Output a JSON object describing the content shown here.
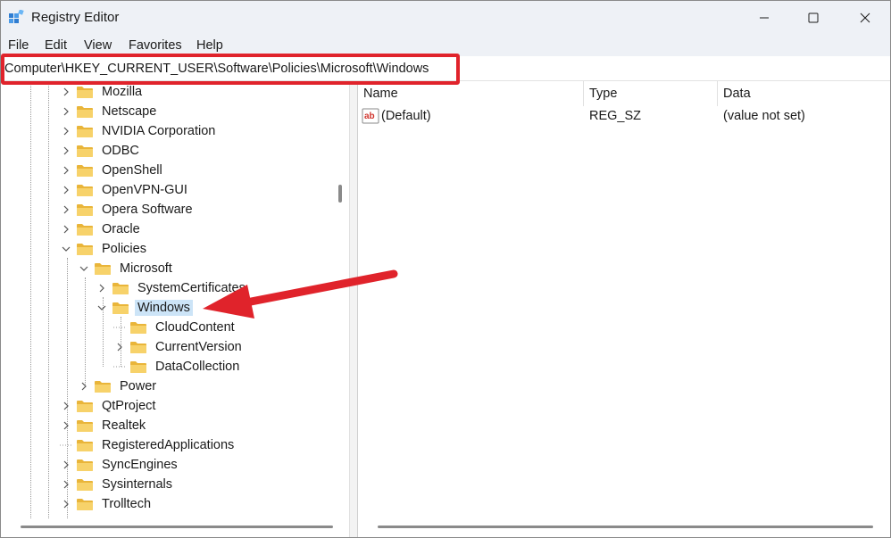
{
  "window": {
    "title": "Registry Editor"
  },
  "menu": {
    "items": [
      "File",
      "Edit",
      "View",
      "Favorites",
      "Help"
    ]
  },
  "address": {
    "path": "Computer\\HKEY_CURRENT_USER\\Software\\Policies\\Microsoft\\Windows"
  },
  "tree": {
    "items": [
      {
        "label": "Mozilla",
        "level": 0,
        "expander": "collapsed"
      },
      {
        "label": "Netscape",
        "level": 0,
        "expander": "collapsed"
      },
      {
        "label": "NVIDIA Corporation",
        "level": 0,
        "expander": "collapsed"
      },
      {
        "label": "ODBC",
        "level": 0,
        "expander": "collapsed"
      },
      {
        "label": "OpenShell",
        "level": 0,
        "expander": "collapsed"
      },
      {
        "label": "OpenVPN-GUI",
        "level": 0,
        "expander": "collapsed"
      },
      {
        "label": "Opera Software",
        "level": 0,
        "expander": "collapsed"
      },
      {
        "label": "Oracle",
        "level": 0,
        "expander": "collapsed"
      },
      {
        "label": "Policies",
        "level": 0,
        "expander": "expanded"
      },
      {
        "label": "Microsoft",
        "level": 1,
        "expander": "expanded"
      },
      {
        "label": "SystemCertificates",
        "level": 2,
        "expander": "collapsed"
      },
      {
        "label": "Windows",
        "level": 2,
        "expander": "expanded",
        "selected": true
      },
      {
        "label": "CloudContent",
        "level": 3,
        "expander": "none"
      },
      {
        "label": "CurrentVersion",
        "level": 3,
        "expander": "collapsed"
      },
      {
        "label": "DataCollection",
        "level": 3,
        "expander": "none"
      },
      {
        "label": "Power",
        "level": 1,
        "expander": "collapsed"
      },
      {
        "label": "QtProject",
        "level": 0,
        "expander": "collapsed"
      },
      {
        "label": "Realtek",
        "level": 0,
        "expander": "collapsed"
      },
      {
        "label": "RegisteredApplications",
        "level": 0,
        "expander": "none"
      },
      {
        "label": "SyncEngines",
        "level": 0,
        "expander": "collapsed"
      },
      {
        "label": "Sysinternals",
        "level": 0,
        "expander": "collapsed"
      },
      {
        "label": "Trolltech",
        "level": 0,
        "expander": "collapsed"
      }
    ]
  },
  "list": {
    "columns": [
      "Name",
      "Type",
      "Data"
    ],
    "rows": [
      {
        "name": "(Default)",
        "type": "REG_SZ",
        "data": "(value not set)",
        "icon": "string-value-icon"
      }
    ]
  },
  "colors": {
    "highlight_border": "#e0232b",
    "annotation_arrow": "#e0232b",
    "selection": "#cce4f7",
    "folder": "#f4c84a"
  }
}
